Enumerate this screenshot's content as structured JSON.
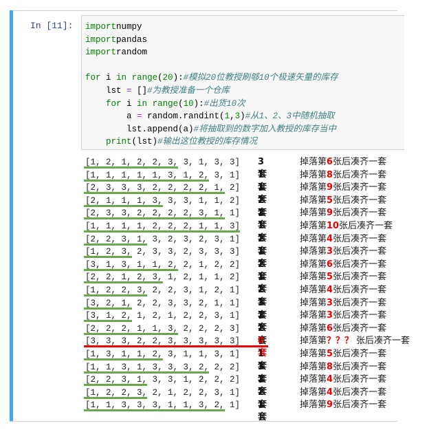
{
  "cell": {
    "prompt": "In [11]:"
  },
  "code": [
    [
      [
        "kw",
        "import"
      ],
      [
        "",
        "numpy"
      ]
    ],
    [
      [
        "kw",
        "import"
      ],
      [
        "",
        "pandas"
      ]
    ],
    [
      [
        "kw",
        "import"
      ],
      [
        "",
        "random"
      ]
    ],
    [],
    [
      [
        "kw",
        "for"
      ],
      [
        "",
        " i "
      ],
      [
        "kw",
        "in"
      ],
      [
        "",
        " "
      ],
      [
        "bi",
        "range"
      ],
      [
        "",
        "("
      ],
      [
        "num",
        "20"
      ],
      [
        "",
        "):"
      ],
      [
        "cm",
        "#模拟20位教授刷够10个极速矢量的库存"
      ]
    ],
    [
      [
        "",
        "    lst "
      ],
      [
        "op",
        "="
      ],
      [
        "",
        " []"
      ],
      [
        "cm",
        "#为教授准备一个仓库"
      ]
    ],
    [
      [
        "",
        "    "
      ],
      [
        "kw",
        "for"
      ],
      [
        "",
        " i "
      ],
      [
        "kw",
        "in"
      ],
      [
        "",
        " "
      ],
      [
        "bi",
        "range"
      ],
      [
        "",
        "("
      ],
      [
        "num",
        "10"
      ],
      [
        "",
        "):"
      ],
      [
        "cm",
        "#出货10次"
      ]
    ],
    [
      [
        "",
        "        a "
      ],
      [
        "op",
        "="
      ],
      [
        "",
        " random.randint("
      ],
      [
        "num",
        "1"
      ],
      [
        "",
        ","
      ],
      [
        "num",
        "3"
      ],
      [
        "",
        ")"
      ],
      [
        "cm",
        "#从1、2、3中随机抽取"
      ]
    ],
    [
      [
        "",
        "        lst.append(a)"
      ],
      [
        "cm",
        "#将抽取到的数字加入教授的库存当中"
      ]
    ],
    [
      [
        "",
        "    "
      ],
      [
        "bi",
        "print"
      ],
      [
        "",
        "(lst)"
      ],
      [
        "cm",
        "#输出这位教授的库存情况"
      ]
    ]
  ],
  "rows": [
    {
      "list": "[1, 2, 1, 2, 2, 3, 3, 1, 3, 3]",
      "count": "3套",
      "pre": "掉落第",
      "n": "6",
      "post": "张后凑齐一套",
      "k": 6
    },
    {
      "list": "[1, 1, 1, 1, 1, 3, 1, 2, 3, 1]",
      "count": "1套",
      "pre": "掉落第",
      "n": "8",
      "post": "张后凑齐一套",
      "k": 8
    },
    {
      "list": "[2, 3, 3, 3, 2, 2, 2, 2, 1, 2]",
      "count": "1套",
      "pre": "掉落第",
      "n": "9",
      "post": "张后凑齐一套",
      "k": 9
    },
    {
      "list": "[2, 1, 1, 1, 3, 3, 3, 1, 1, 2]",
      "count": "2套",
      "pre": "掉落第",
      "n": "5",
      "post": "张后凑齐一套",
      "k": 5
    },
    {
      "list": "[2, 3, 3, 2, 2, 2, 2, 3, 1, 1]",
      "count": "2套",
      "pre": "掉落第",
      "n": "9",
      "post": "张后凑齐一套",
      "k": 9
    },
    {
      "list": "[1, 1, 1, 1, 2, 2, 2, 1, 1, 3]",
      "count": "1套",
      "pre": "掉落第",
      "n": "10",
      "post": "张后凑齐一套",
      "k": 10
    },
    {
      "list": "[2, 2, 3, 1, 3, 2, 3, 2, 3, 1]",
      "count": "2套",
      "pre": "掉落第",
      "n": "4",
      "post": "张后凑齐一套",
      "k": 4
    },
    {
      "list": "[1, 2, 3, 2, 3, 3, 2, 3, 3, 3]",
      "count": "1套",
      "pre": "掉落第",
      "n": "3",
      "post": "张后凑齐一套",
      "k": 3
    },
    {
      "list": "[3, 1, 3, 1, 1, 2, 2, 1, 2, 2]",
      "count": "2套",
      "pre": "掉落第",
      "n": "6",
      "post": "张后凑齐一套",
      "k": 6
    },
    {
      "list": "[2, 2, 1, 2, 3, 1, 2, 1, 1, 2]",
      "count": "1套",
      "pre": "掉落第",
      "n": "5",
      "post": "张后凑齐一套",
      "k": 5
    },
    {
      "list": "[1, 2, 2, 3, 2, 2, 3, 1, 2, 1]",
      "count": "2套",
      "pre": "掉落第",
      "n": "4",
      "post": "张后凑齐一套",
      "k": 4
    },
    {
      "list": "[3, 2, 1, 2, 2, 3, 3, 2, 1, 1]",
      "count": "3套",
      "pre": "掉落第",
      "n": "3",
      "post": "张后凑齐一套",
      "k": 3
    },
    {
      "list": "[3, 1, 2, 1, 2, 1, 2, 2, 3, 1]",
      "count": "2套",
      "pre": "掉落第",
      "n": "3",
      "post": "张后凑齐一套",
      "k": 3
    },
    {
      "list": "[2, 2, 2, 1, 1, 3, 2, 2, 2, 3]",
      "count": "2套",
      "pre": "掉落第",
      "n": "6",
      "post": "张后凑齐一套",
      "k": 6
    },
    {
      "list": "[3, 3, 3, 2, 2, 3, 3, 3, 3, 3]",
      "count": "0套",
      "pre": "掉落第",
      "n": "？？？",
      "post": "张后凑齐一套",
      "k": 0,
      "fail": true
    },
    {
      "list": "[1, 3, 1, 1, 2, 3, 1, 1, 3, 1]",
      "count": "1套",
      "pre": "掉落第",
      "n": "5",
      "post": "张后凑齐一套",
      "k": 5
    },
    {
      "list": "[1, 1, 3, 1, 3, 3, 3, 2, 2, 2]",
      "count": "3套",
      "pre": "掉落第",
      "n": "8",
      "post": "张后凑齐一套",
      "k": 8
    },
    {
      "list": "[2, 2, 3, 1, 3, 3, 1, 2, 2, 2]",
      "count": "2套",
      "pre": "掉落第",
      "n": "4",
      "post": "张后凑齐一套",
      "k": 4
    },
    {
      "list": "[1, 2, 2, 3, 2, 1, 2, 2, 3, 1]",
      "count": "2套",
      "pre": "掉落第",
      "n": "4",
      "post": "张后凑齐一套",
      "k": 4
    },
    {
      "list": "[1, 1, 3, 3, 3, 1, 1, 3, 2, 1]",
      "count": "1套",
      "pre": "掉落第",
      "n": "9",
      "post": "张后凑齐一套",
      "k": 9
    }
  ],
  "colors": {
    "accent": "#42a5f5",
    "underline": "#6aa84f",
    "highlight": "#e00000"
  }
}
